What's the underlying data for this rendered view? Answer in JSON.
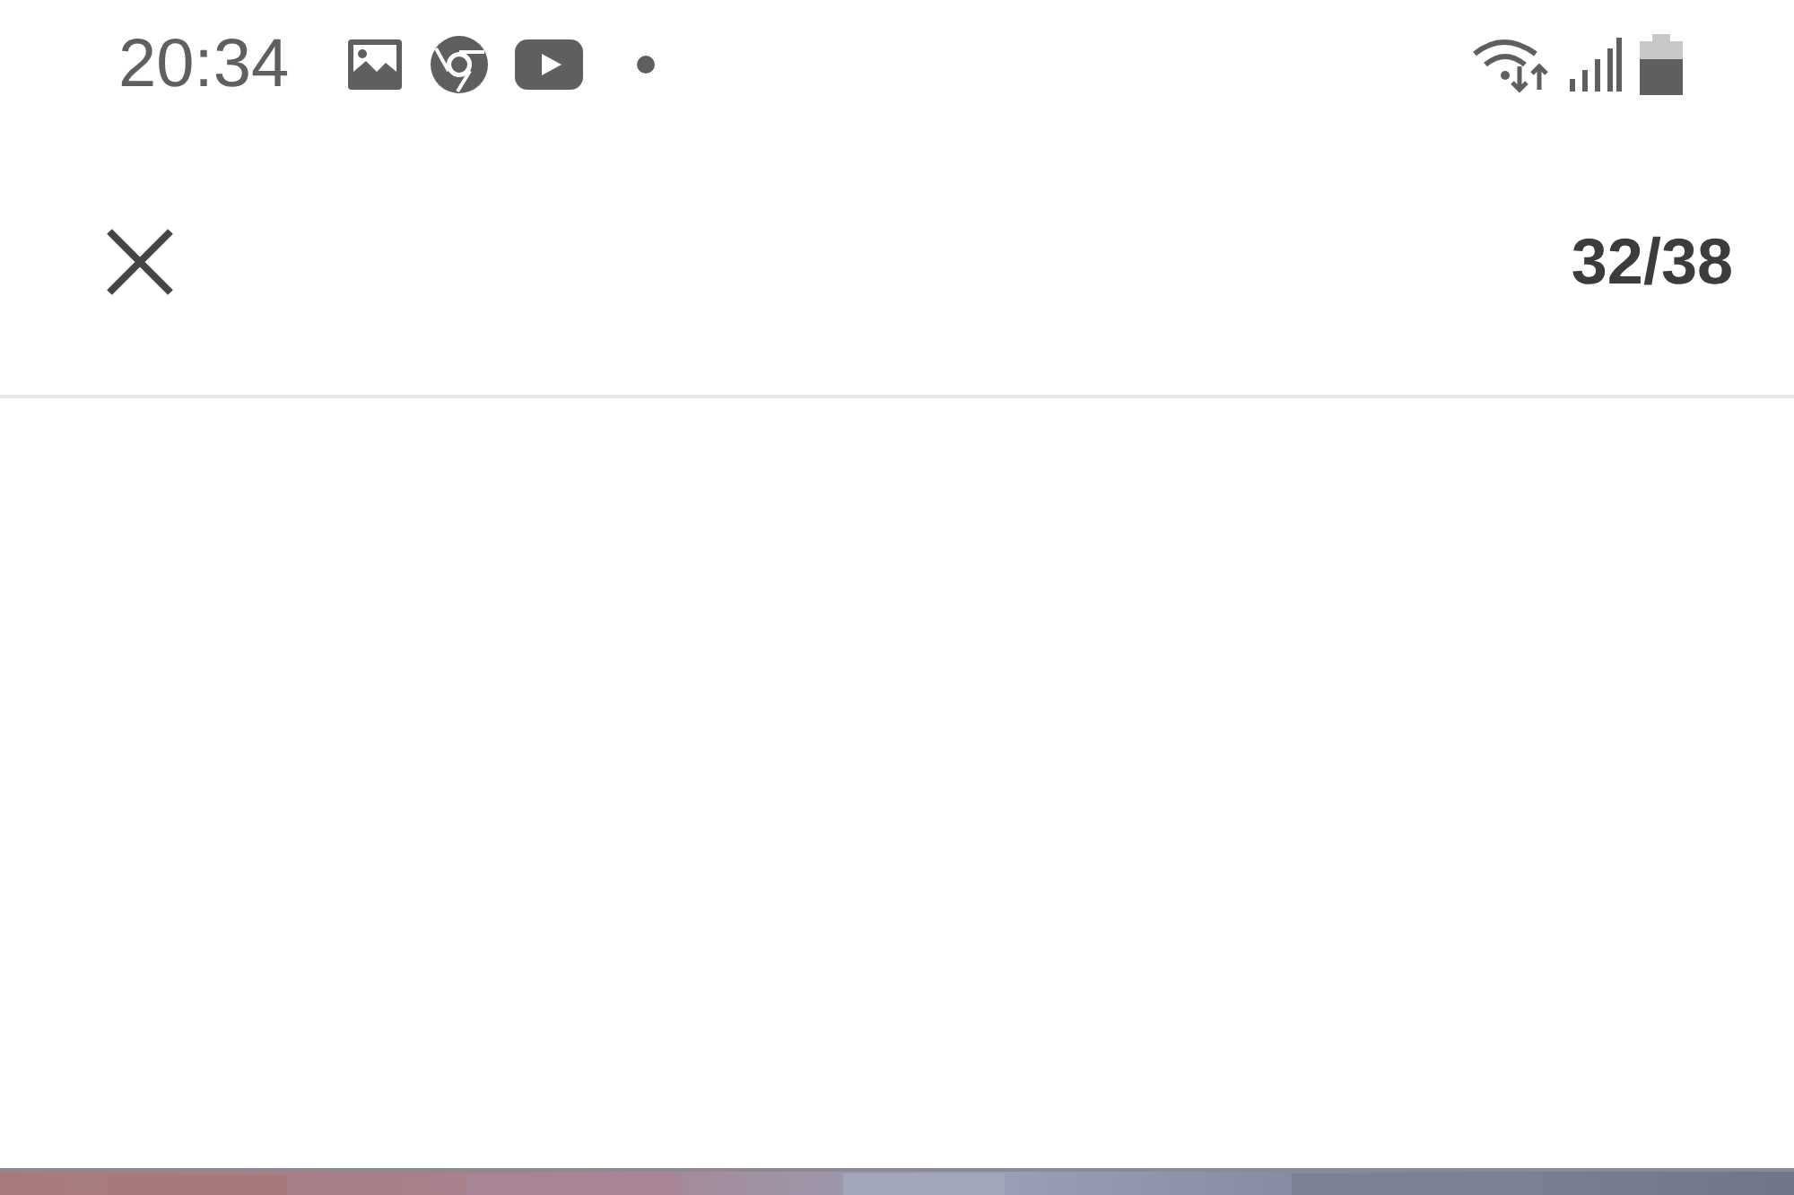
{
  "status_bar": {
    "time": "20:34"
  },
  "top_bar": {
    "counter": "32/38"
  }
}
